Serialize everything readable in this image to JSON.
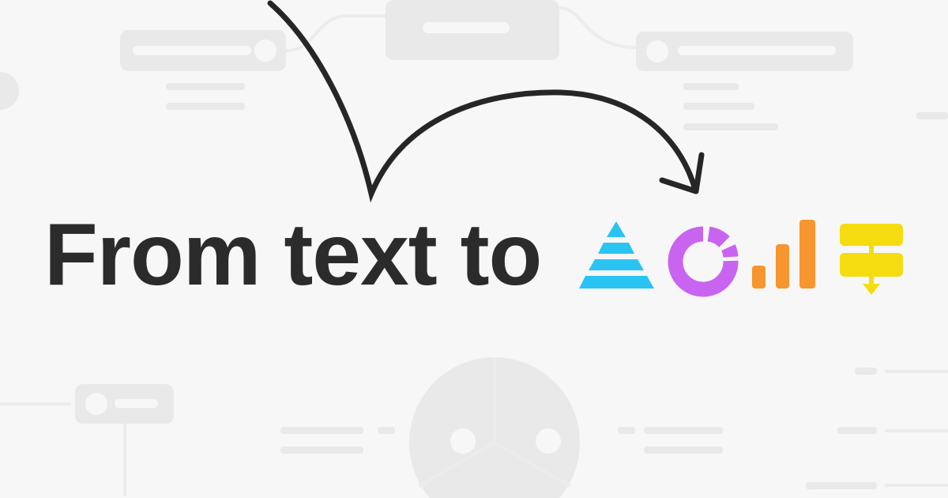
{
  "headline": "From text to",
  "icons": [
    {
      "name": "pyramid-icon",
      "color": "#29c4f2"
    },
    {
      "name": "donut-chart-icon",
      "color": "#c964f0"
    },
    {
      "name": "bar-chart-icon",
      "color": "#f7952f"
    },
    {
      "name": "flowchart-icon",
      "color": "#f5dc10"
    }
  ],
  "colors": {
    "background": "#f7f7f7",
    "text": "#2b2b2b",
    "decor": "#e9e9e9"
  }
}
